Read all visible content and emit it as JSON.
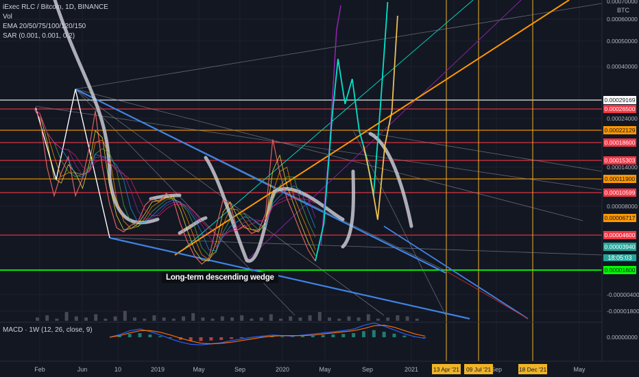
{
  "header": {
    "symbol_line": "iExec RLC / Bitcoin, 1D, BINANCE",
    "vol_label": "Vol",
    "ema_label": "EMA 20/50/75/100/120/150",
    "sar_label": "SAR (0.001, 0.001, 0.2)",
    "macd_label": "MACD · 1W (12, 26, close, 9)",
    "scale_unit": "BTC"
  },
  "annotation": {
    "text": "Long-term descending wedge"
  },
  "cursor_time": "18:05:03",
  "colors": {
    "background": "#131722",
    "red_level": "#f23645",
    "green_level": "#00ff00",
    "orange": "#ff9800",
    "blue_trend": "#3f84e5",
    "gray_projection": "#c8c8d0",
    "teal_projection": "#00e5cc",
    "gold_projection": "#f0c050",
    "violet_projection": "#8e24aa"
  },
  "chart_data": {
    "type": "line",
    "pair": "iExec RLC / Bitcoin",
    "timeframe": "1D",
    "exchange": "BINANCE",
    "x_ticks": [
      "Feb",
      "Jun",
      "10",
      "2019",
      "May",
      "Sep",
      "2020",
      "May",
      "Sep",
      "2021",
      "May",
      "Sep",
      "May"
    ],
    "y_ticks": [
      "0.00070000",
      "0.00060000",
      "0.00050000",
      "0.00040000",
      "0.00024000",
      "0.00014000",
      "0.00008000",
      "-0.00000400",
      "-0.00001800"
    ],
    "macd_y_ticks": [
      "0.00000000"
    ],
    "price_labels": [
      {
        "value": "0.00029169",
        "style": "white"
      },
      {
        "value": "0.00026500",
        "style": "red"
      },
      {
        "value": "0.00022129",
        "style": "orange"
      },
      {
        "value": "0.00018600",
        "style": "red"
      },
      {
        "value": "0.00015303",
        "style": "red"
      },
      {
        "value": "0.00011900",
        "style": "orange"
      },
      {
        "value": "0.00010599",
        "style": "red"
      },
      {
        "value": "0.00006717",
        "style": "orange"
      },
      {
        "value": "0.00004600",
        "style": "red"
      },
      {
        "value": "0.00003940",
        "style": "teal"
      },
      {
        "value": "0.00001600",
        "style": "green"
      }
    ],
    "horizontal_levels": [
      {
        "value": 0.00029169,
        "color": "#ffffff"
      },
      {
        "value": 0.000265,
        "color": "#f23645"
      },
      {
        "value": 0.00022129,
        "color": "#ff9800"
      },
      {
        "value": 0.000186,
        "color": "#f23645"
      },
      {
        "value": 0.00015303,
        "color": "#f23645"
      },
      {
        "value": 0.000119,
        "color": "#ff9800"
      },
      {
        "value": 0.00010599,
        "color": "#f23645"
      },
      {
        "value": 4.6e-05,
        "color": "#f23645"
      },
      {
        "value": 1.6e-05,
        "color": "#00ff00"
      }
    ],
    "highlighted_dates": [
      "13 Apr '21",
      "09 Jul '21",
      "18 Dec '21"
    ],
    "price": [
      {
        "t": 0.0,
        "v": 0.000265
      },
      {
        "t": 0.4,
        "v": 0.00024
      },
      {
        "t": 0.9,
        "v": 0.00014
      },
      {
        "t": 1.4,
        "v": 0.0001
      },
      {
        "t": 1.9,
        "v": 0.00013
      },
      {
        "t": 2.4,
        "v": 0.00016
      },
      {
        "t": 2.9,
        "v": 0.0001
      },
      {
        "t": 3.4,
        "v": 0.00012
      },
      {
        "t": 3.9,
        "v": 0.00018
      },
      {
        "t": 4.3,
        "v": 0.00026
      },
      {
        "t": 4.8,
        "v": 0.00014
      },
      {
        "t": 5.3,
        "v": 8.5e-05
      },
      {
        "t": 5.8,
        "v": 5.5e-05
      },
      {
        "t": 6.3,
        "v": 5e-05
      },
      {
        "t": 6.8,
        "v": 5.8e-05
      },
      {
        "t": 7.3,
        "v": 6.2e-05
      },
      {
        "t": 7.8,
        "v": 8.2e-05
      },
      {
        "t": 8.3,
        "v": 9.5e-05
      },
      {
        "t": 8.8,
        "v": 8.8e-05
      },
      {
        "t": 9.3,
        "v": 0.000105
      },
      {
        "t": 9.8,
        "v": 9.2e-05
      },
      {
        "t": 10.3,
        "v": 6e-05
      },
      {
        "t": 10.8,
        "v": 4.2e-05
      },
      {
        "t": 11.3,
        "v": 3e-05
      },
      {
        "t": 11.8,
        "v": 2.2e-05
      },
      {
        "t": 12.3,
        "v": 2.8e-05
      },
      {
        "t": 12.8,
        "v": 5.5e-05
      },
      {
        "t": 13.3,
        "v": 9.2e-05
      },
      {
        "t": 13.8,
        "v": 8.5e-05
      },
      {
        "t": 14.3,
        "v": 5.2e-05
      },
      {
        "t": 14.8,
        "v": 5.8e-05
      },
      {
        "t": 15.3,
        "v": 4.8e-05
      },
      {
        "t": 15.8,
        "v": 5.2e-05
      },
      {
        "t": 16.3,
        "v": 7.2e-05
      },
      {
        "t": 16.8,
        "v": 0.000195
      },
      {
        "t": 17.3,
        "v": 0.00013
      },
      {
        "t": 17.8,
        "v": 9.5e-05
      },
      {
        "t": 18.3,
        "v": 7e-05
      },
      {
        "t": 18.8,
        "v": 4.8e-05
      },
      {
        "t": 19.3,
        "v": 3.6e-05
      },
      {
        "t": 19.8,
        "v": 2.5e-05
      }
    ],
    "projection_teal": [
      {
        "t": 19.8,
        "v": 2.5e-05
      },
      {
        "t": 20.4,
        "v": 6e-05
      },
      {
        "t": 21.0,
        "v": 0.00025
      },
      {
        "t": 21.4,
        "v": 0.00043
      },
      {
        "t": 21.9,
        "v": 0.00028
      },
      {
        "t": 22.4,
        "v": 0.00036
      },
      {
        "t": 22.9,
        "v": 0.00022
      },
      {
        "t": 23.4,
        "v": 0.00016
      },
      {
        "t": 23.9,
        "v": 0.0001
      },
      {
        "t": 24.4,
        "v": 0.00028
      },
      {
        "t": 24.9,
        "v": 0.00072
      }
    ],
    "projection_gold": [
      {
        "t": 23.2,
        "v": 0.00018
      },
      {
        "t": 23.7,
        "v": 0.00012
      },
      {
        "t": 24.2,
        "v": 6.5e-05
      },
      {
        "t": 24.7,
        "v": 0.00018
      },
      {
        "t": 25.2,
        "v": 0.00026
      },
      {
        "t": 25.6,
        "v": 0.00062
      }
    ],
    "projection_violet": [
      {
        "t": 20.2,
        "v": 4e-05
      },
      {
        "t": 20.8,
        "v": 0.00018
      },
      {
        "t": 21.3,
        "v": 0.00055
      },
      {
        "t": 21.6,
        "v": 0.00068
      }
    ],
    "volume": [
      3,
      5,
      2,
      8,
      4,
      3,
      6,
      2,
      4,
      9,
      3,
      2,
      5,
      3,
      2,
      4,
      7,
      3,
      2,
      4,
      3,
      5,
      2,
      3,
      6,
      2,
      4,
      3,
      5,
      8,
      3,
      2,
      4,
      3,
      6,
      2,
      3,
      5,
      4,
      2
    ],
    "macd": [
      0,
      0.5,
      1.2,
      1.5,
      1.0,
      0.4,
      -0.3,
      -0.9,
      -1.3,
      -1.4,
      -1.2,
      -1.0,
      -0.6,
      -0.3,
      0,
      0.2,
      0.4,
      0.3,
      0.2,
      0.4,
      0.6,
      0.8,
      1.0,
      1.2,
      1.5,
      2.2,
      2.6,
      2.0,
      1.3,
      0.6,
      0.1,
      -0.2
    ],
    "macd_signal": [
      0,
      0.3,
      0.8,
      1.2,
      1.2,
      0.9,
      0.4,
      -0.2,
      -0.7,
      -1.1,
      -1.2,
      -1.1,
      -0.9,
      -0.6,
      -0.3,
      0,
      0.2,
      0.3,
      0.3,
      0.3,
      0.4,
      0.6,
      0.8,
      1.0,
      1.2,
      1.6,
      2.1,
      2.2,
      1.8,
      1.2,
      0.6,
      0.2
    ]
  }
}
